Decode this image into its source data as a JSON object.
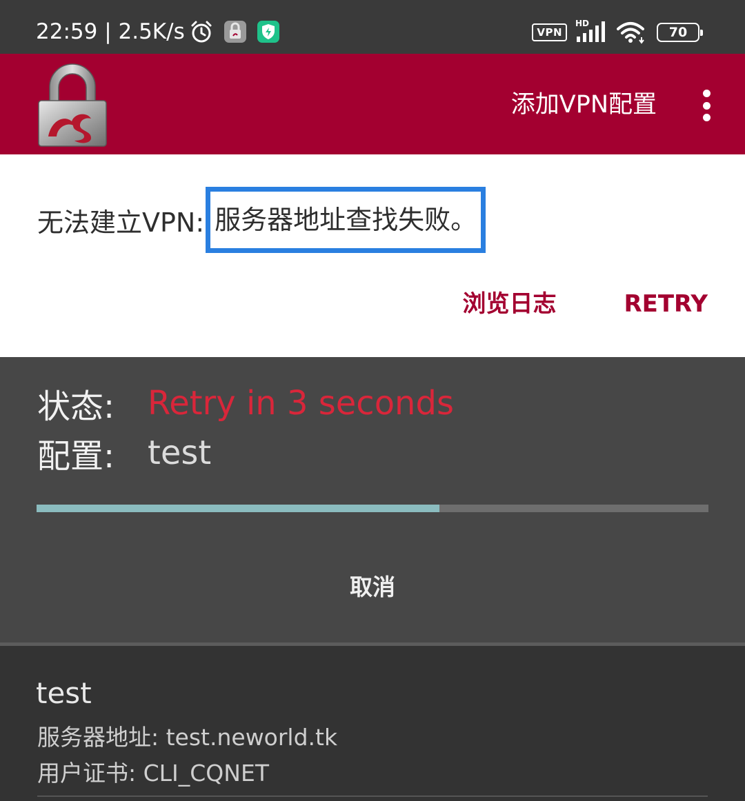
{
  "status_bar": {
    "time_speed": "22:59 | 2.5K/s",
    "vpn_badge": "VPN",
    "network_badge": "HD",
    "battery": "70"
  },
  "app_bar": {
    "add_vpn_label": "添加VPN配置"
  },
  "error_card": {
    "prefix": "无法建立VPN:",
    "highlight": "服务器地址查找失败。",
    "view_log": "浏览日志",
    "retry": "RETRY"
  },
  "status_panel": {
    "state_label": "状态:",
    "state_value": "Retry in 3 seconds",
    "profile_label": "配置:",
    "profile_value": "test",
    "progress_fraction": 0.6,
    "cancel_label": "取消"
  },
  "profile": {
    "name": "test",
    "server": "服务器地址: test.neworld.tk",
    "cert": "用户证书: CLI_CQNET"
  },
  "colors": {
    "brand": "#a30030",
    "status_error": "#d9263a",
    "highlight_border": "#2a7fe0",
    "progress": "#8bbcbf"
  }
}
